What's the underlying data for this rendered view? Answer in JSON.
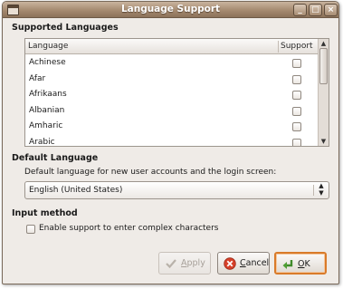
{
  "window": {
    "title": "Language Support"
  },
  "supported": {
    "heading": "Supported Languages",
    "col_language": "Language",
    "col_support": "Support",
    "languages": [
      "Achinese",
      "Afar",
      "Afrikaans",
      "Albanian",
      "Amharic",
      "Arabic"
    ]
  },
  "default_lang": {
    "heading": "Default Language",
    "description": "Default language for new user accounts and the login screen:",
    "selected": "English (United States)"
  },
  "input_method": {
    "heading": "Input method",
    "complex_label": "Enable support to enter complex characters"
  },
  "buttons": {
    "apply_first": "A",
    "apply_rest": "pply",
    "cancel_first": "C",
    "cancel_rest": "ancel",
    "ok_first": "O",
    "ok_rest": "K"
  },
  "colors": {
    "title_bar": "#a58a70",
    "window_bg": "#efebe7",
    "default_button_border": "#d97b2a"
  }
}
